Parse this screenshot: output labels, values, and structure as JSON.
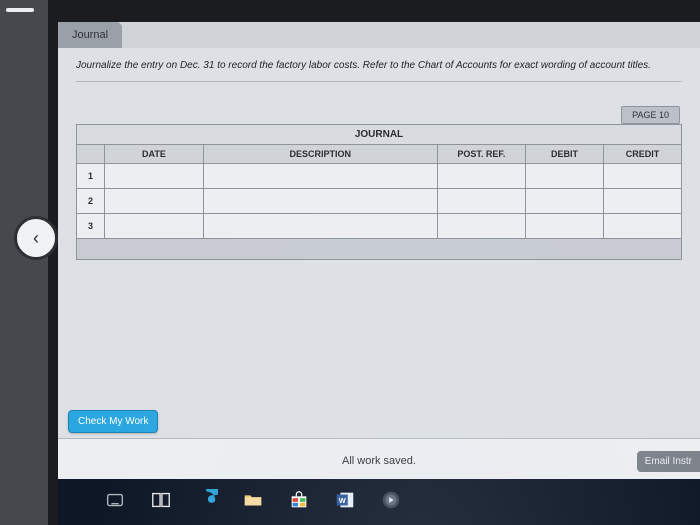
{
  "nav": {
    "back_glyph": "‹"
  },
  "tab": {
    "label": "Journal"
  },
  "instruction": "Journalize the entry on Dec. 31 to record the factory labor costs. Refer to the Chart of Accounts for exact wording of account titles.",
  "journal": {
    "page_label": "PAGE 10",
    "title": "JOURNAL",
    "columns": {
      "date": "DATE",
      "description": "DESCRIPTION",
      "post_ref": "POST. REF.",
      "debit": "DEBIT",
      "credit": "CREDIT"
    },
    "row_labels": [
      "1",
      "2",
      "3"
    ],
    "rows": [
      {
        "date": "",
        "description": "",
        "post_ref": "",
        "debit": "",
        "credit": ""
      },
      {
        "date": "",
        "description": "",
        "post_ref": "",
        "debit": "",
        "credit": ""
      },
      {
        "date": "",
        "description": "",
        "post_ref": "",
        "debit": "",
        "credit": ""
      }
    ]
  },
  "buttons": {
    "check_my_work": "Check My Work",
    "email_instructor": "Email Instr"
  },
  "status": {
    "saved": "All work saved."
  },
  "taskbar": {
    "icons": [
      "keyboard-icon",
      "task-view-icon",
      "edge-icon",
      "file-explorer-icon",
      "store-icon",
      "word-icon",
      "media-icon"
    ]
  }
}
